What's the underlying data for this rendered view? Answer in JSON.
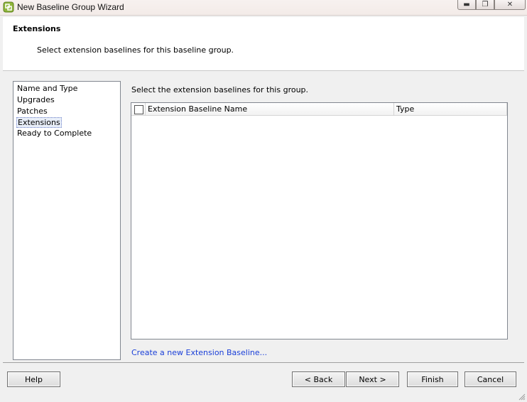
{
  "window": {
    "title": "New Baseline Group Wizard"
  },
  "header": {
    "title": "Extensions",
    "description": "Select extension baselines for this baseline group."
  },
  "steps": [
    {
      "label": "Name and Type"
    },
    {
      "label": "Upgrades"
    },
    {
      "label": "Patches"
    },
    {
      "label": "Extensions",
      "active": true
    },
    {
      "label": "Ready to Complete"
    }
  ],
  "main": {
    "instruction": "Select the extension baselines for this group.",
    "table": {
      "columns": [
        "Extension Baseline Name",
        "Type"
      ],
      "rows": []
    },
    "create_link": "Create a new Extension Baseline..."
  },
  "buttons": {
    "help": "Help",
    "back": "< Back",
    "next": "Next >",
    "finish": "Finish",
    "cancel": "Cancel"
  },
  "colors": {
    "link": "#1a3fd8",
    "selection_border": "#6a7ec8"
  }
}
